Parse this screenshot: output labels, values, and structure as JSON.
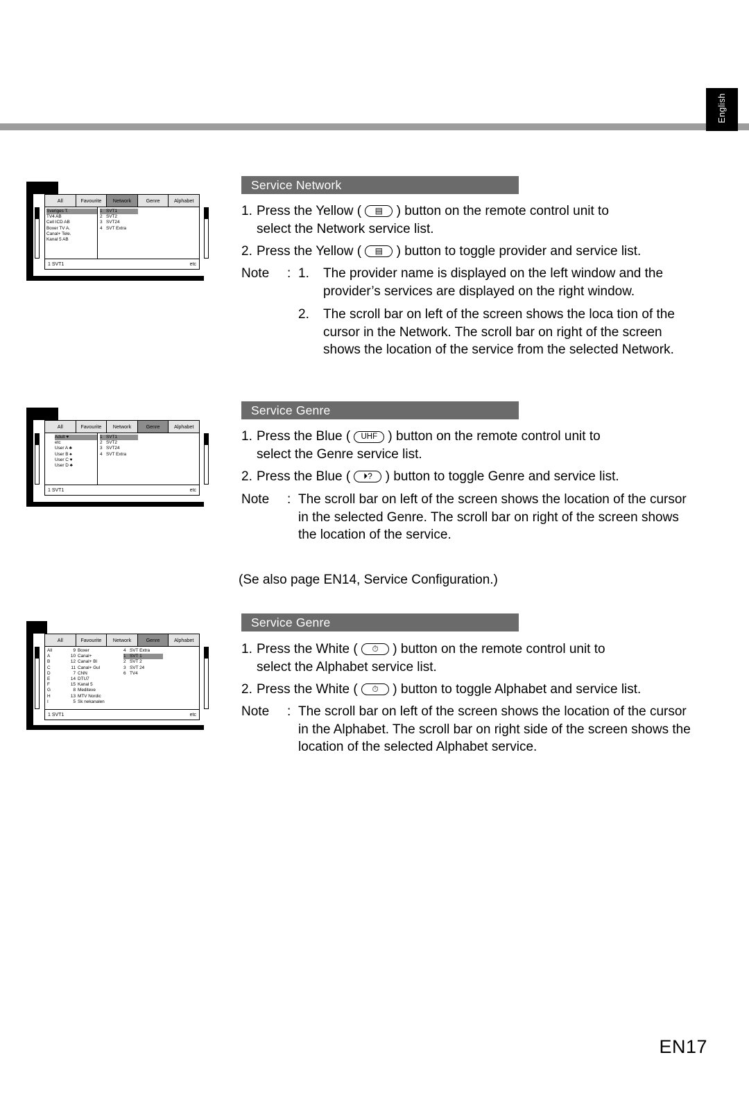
{
  "page": {
    "language_tab": "English",
    "page_number": "EN17",
    "standalone_note": "(Se also page EN14, Service Configuration.)"
  },
  "sections": [
    {
      "id": "service-network",
      "title": "Service Network",
      "steps": [
        {
          "num": "1.",
          "pre": "Press the Yellow (",
          "pill": "▤",
          "post": ") button on the remote control unit to",
          "line2": "select the Network service list."
        },
        {
          "num": "2.",
          "pre": "Press the Yellow (",
          "pill": "▤",
          "post": ") button to toggle provider and service list.",
          "line2": ""
        }
      ],
      "note_label": "Note",
      "note_colon": ":",
      "notes": [
        {
          "num": "1.",
          "text": "The provider name is displayed on the left window and the provider’s services are displayed on the right window."
        },
        {
          "num": "2.",
          "text": "The scroll bar on left of the screen shows the loca tion of the cursor in the Network. The scroll bar on right of the screen shows the location of the service from the selected Network."
        }
      ]
    },
    {
      "id": "service-genre",
      "title": "Service Genre",
      "steps": [
        {
          "num": "1.",
          "pre": "Press the Blue (",
          "pill": "UHF",
          "post": ") button on the remote control unit to",
          "line2": "select the Genre service list."
        },
        {
          "num": "2.",
          "pre": "Press the Blue (",
          "pill": "⏵?",
          "post": ") button to toggle Genre and service list.",
          "line2": ""
        }
      ],
      "note_label": "Note",
      "note_colon": ":",
      "notes": [
        {
          "num": "",
          "text": "The scroll bar on left of the screen shows the location of the cursor in the selected Genre. The scroll bar on right of the screen shows the location of the service."
        }
      ]
    },
    {
      "id": "service-alphabet",
      "title": "Service Genre",
      "steps": [
        {
          "num": "1.",
          "pre": "Press the White (",
          "pill": "⏱",
          "post": ") button on the remote control unit to",
          "line2": "select the Alphabet service list."
        },
        {
          "num": "2.",
          "pre": "Press the White (",
          "pill": "⏱",
          "post": ") button to toggle Alphabet and service list.",
          "line2": ""
        }
      ],
      "note_label": "Note",
      "note_colon": ":",
      "notes": [
        {
          "num": "",
          "text": "The scroll bar on left of the screen shows the location of the cursor in the Alphabet. The scroll bar on right side of the screen shows the location of the selected Alphabet service."
        }
      ]
    }
  ],
  "osd_screens": [
    {
      "id": "network",
      "tabs": [
        {
          "label": "All",
          "selected": false
        },
        {
          "label": "Favourite",
          "selected": false
        },
        {
          "label": "Network",
          "selected": true
        },
        {
          "label": "Genre",
          "selected": false
        },
        {
          "label": "Alphabet",
          "selected": false
        }
      ],
      "left_list": [
        {
          "text": "Sveriges T.",
          "highlight": true
        },
        {
          "text": "TV4 AB",
          "highlight": false
        },
        {
          "text": "Cell ICD AB",
          "highlight": false
        },
        {
          "text": "Boxer TV A.",
          "highlight": false
        },
        {
          "text": "Canal+ Tele.",
          "highlight": false
        },
        {
          "text": "Kanal 5 AB",
          "highlight": false
        }
      ],
      "right_list": [
        {
          "idx": "1",
          "text": "SVT1",
          "highlight": true
        },
        {
          "idx": "2",
          "text": "SVT2",
          "highlight": false
        },
        {
          "idx": "3",
          "text": "SVT24",
          "highlight": false
        },
        {
          "idx": "4",
          "text": "SVT Extra",
          "highlight": false
        }
      ],
      "status_left": "1   SVT1",
      "status_right": "etc"
    },
    {
      "id": "genre",
      "tabs": [
        {
          "label": "All",
          "selected": false
        },
        {
          "label": "Favourite",
          "selected": false
        },
        {
          "label": "Network",
          "selected": false
        },
        {
          "label": "Genre",
          "selected": true
        },
        {
          "label": "Alphabet",
          "selected": false
        }
      ],
      "left_list": [
        {
          "text": "Adult ♥",
          "highlight": true
        },
        {
          "text": "etc",
          "highlight": false
        },
        {
          "text": "User A ♣",
          "highlight": false
        },
        {
          "text": "User B ♠",
          "highlight": false
        },
        {
          "text": "User C ♥",
          "highlight": false
        },
        {
          "text": "User D ♣",
          "highlight": false
        }
      ],
      "right_list": [
        {
          "idx": "1",
          "text": "SVT1",
          "highlight": true
        },
        {
          "idx": "2",
          "text": "SVT2",
          "highlight": false
        },
        {
          "idx": "3",
          "text": "SVT24",
          "highlight": false
        },
        {
          "idx": "4",
          "text": "SVT Extra",
          "highlight": false
        }
      ],
      "status_left": "1   SVT1",
      "status_right": "etc"
    },
    {
      "id": "alphabet",
      "tabs": [
        {
          "label": "All",
          "selected": false
        },
        {
          "label": "Favourite",
          "selected": false
        },
        {
          "label": "Network",
          "selected": false
        },
        {
          "label": "Genre",
          "selected": true
        },
        {
          "label": "Alphabet",
          "selected": false
        }
      ],
      "alpha_col": [
        "All",
        "A",
        "B",
        "C",
        "D",
        "E",
        "F",
        "G",
        "H",
        "I"
      ],
      "mid_list": [
        {
          "idx": "9",
          "text": "Boxer"
        },
        {
          "idx": "10",
          "text": "Canal+"
        },
        {
          "idx": "12",
          "text": "Canal+ Bl"
        },
        {
          "idx": "11",
          "text": "Canal+ Gul"
        },
        {
          "idx": "7",
          "text": "CNN"
        },
        {
          "idx": "14",
          "text": "DTU7"
        },
        {
          "idx": "15",
          "text": "Kanal 5"
        },
        {
          "idx": "8",
          "text": "Mediteve"
        },
        {
          "idx": "13",
          "text": "MTV Nordic"
        },
        {
          "idx": "5",
          "text": "Sk nekanalen"
        }
      ],
      "right_list": [
        {
          "idx": "4",
          "text": "SVT Extra",
          "highlight": false
        },
        {
          "idx": "1",
          "text": "SVT 1",
          "highlight": true
        },
        {
          "idx": "2",
          "text": "SVT 2",
          "highlight": false
        },
        {
          "idx": "3",
          "text": "SVT 24",
          "highlight": false
        },
        {
          "idx": "6",
          "text": "TV4",
          "highlight": false
        }
      ],
      "status_left": "1   SVT1",
      "status_right": "etc"
    }
  ]
}
